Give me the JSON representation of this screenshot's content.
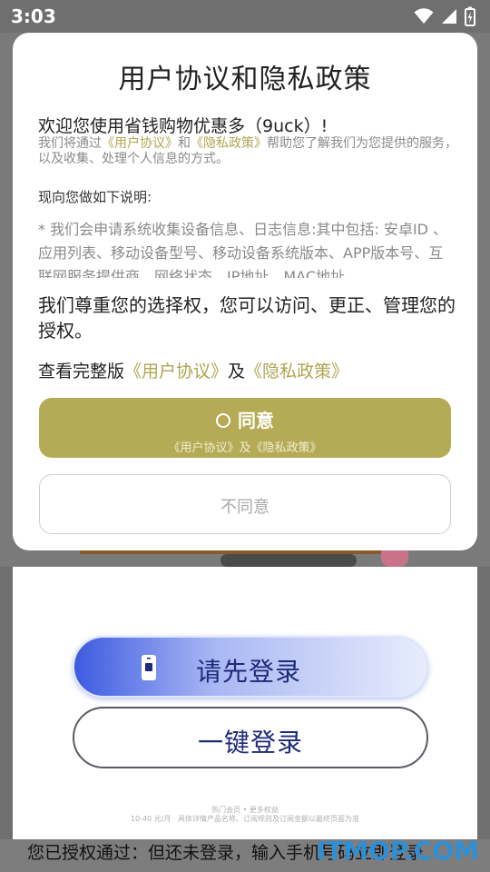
{
  "status_bar": {
    "time": "3:03"
  },
  "dialog": {
    "title": "用户协议和隐私政策",
    "welcome": "欢迎您使用省钱购物优惠多（9uck）!",
    "intro": {
      "prefix": "我们将通过",
      "user_agreement": "《用户协议》",
      "and": "和",
      "privacy_policy": "《隐私政策》",
      "suffix": "帮助您了解我们为您提供的服务，以及收集、处理个人信息的方式。"
    },
    "notice": "现向您做如下说明:",
    "details": "* 我们会申请系统收集设备信息、日志信息:其中包括: 安卓ID 、应用列表、移动设备型号、移动设备系统版本、APP版本号、互联网服务提供商、网络状态、IP地址、MAC地址",
    "respect": "我们尊重您的选择权，您可以访问、更正、管理您的授权。",
    "full_version": {
      "prefix": "查看完整版",
      "user_agreement": "《用户协议》",
      "and": "及",
      "privacy_policy": "《隐私政策》"
    },
    "agree_button": {
      "label": "同意",
      "sub_label": "《用户协议》及《隐私政策》"
    },
    "disagree_button": {
      "label": "不同意"
    }
  },
  "background_app": {
    "login_button": "请先登录",
    "one_key_login_button": "一键登录",
    "fine_print_1": "热门会员 • 更多权益",
    "fine_print_2": "10-40 元/月 · 具体详情产品名称、订阅规则及订阅金额以最终页面为准",
    "bottom_text": "您已授权通过：但还未登录，输入手机号码立即登录"
  },
  "watermark": "ITMOP.COM",
  "colors": {
    "accent": "#b5aa55",
    "link": "#b0a552",
    "login_blue": "#3d5be0"
  }
}
